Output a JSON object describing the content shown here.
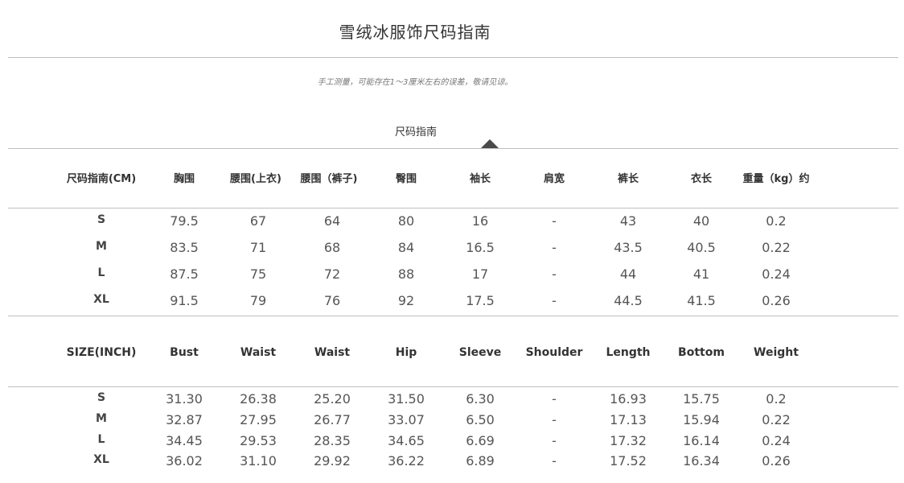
{
  "title": "雪绒冰服饰尺码指南",
  "note": "手工测量，可能存在1～3厘米左右的误差，敬请见谅。",
  "tab_label": "尺码指南",
  "cm_table": {
    "headers": [
      "尺码指南(CM)",
      "胸围",
      "腰围(上衣)",
      "腰围（裤子)",
      "臀围",
      "袖长",
      "肩宽",
      "裤长",
      "衣长",
      "重量（kg）约"
    ],
    "rows": [
      [
        "S",
        "79.5",
        "67",
        "64",
        "80",
        "16",
        "-",
        "43",
        "40",
        "0.2"
      ],
      [
        "M",
        "83.5",
        "71",
        "68",
        "84",
        "16.5",
        "-",
        "43.5",
        "40.5",
        "0.22"
      ],
      [
        "L",
        "87.5",
        "75",
        "72",
        "88",
        "17",
        "-",
        "44",
        "41",
        "0.24"
      ],
      [
        "XL",
        "91.5",
        "79",
        "76",
        "92",
        "17.5",
        "-",
        "44.5",
        "41.5",
        "0.26"
      ]
    ]
  },
  "inch_table": {
    "headers": [
      "SIZE(INCH)",
      "Bust",
      "Waist",
      "Waist",
      "Hip",
      "Sleeve",
      "Shoulder",
      "Length",
      "Bottom",
      "Weight"
    ],
    "rows": [
      [
        "S",
        "31.30",
        "26.38",
        "25.20",
        "31.50",
        "6.30",
        "-",
        "16.93",
        "15.75",
        "0.2"
      ],
      [
        "M",
        "32.87",
        "27.95",
        "26.77",
        "33.07",
        "6.50",
        "-",
        "17.13",
        "15.94",
        "0.22"
      ],
      [
        "L",
        "34.45",
        "29.53",
        "28.35",
        "34.65",
        "6.69",
        "-",
        "17.32",
        "16.14",
        "0.24"
      ],
      [
        "XL",
        "36.02",
        "31.10",
        "29.92",
        "36.22",
        "6.89",
        "-",
        "17.52",
        "16.34",
        "0.26"
      ]
    ]
  }
}
